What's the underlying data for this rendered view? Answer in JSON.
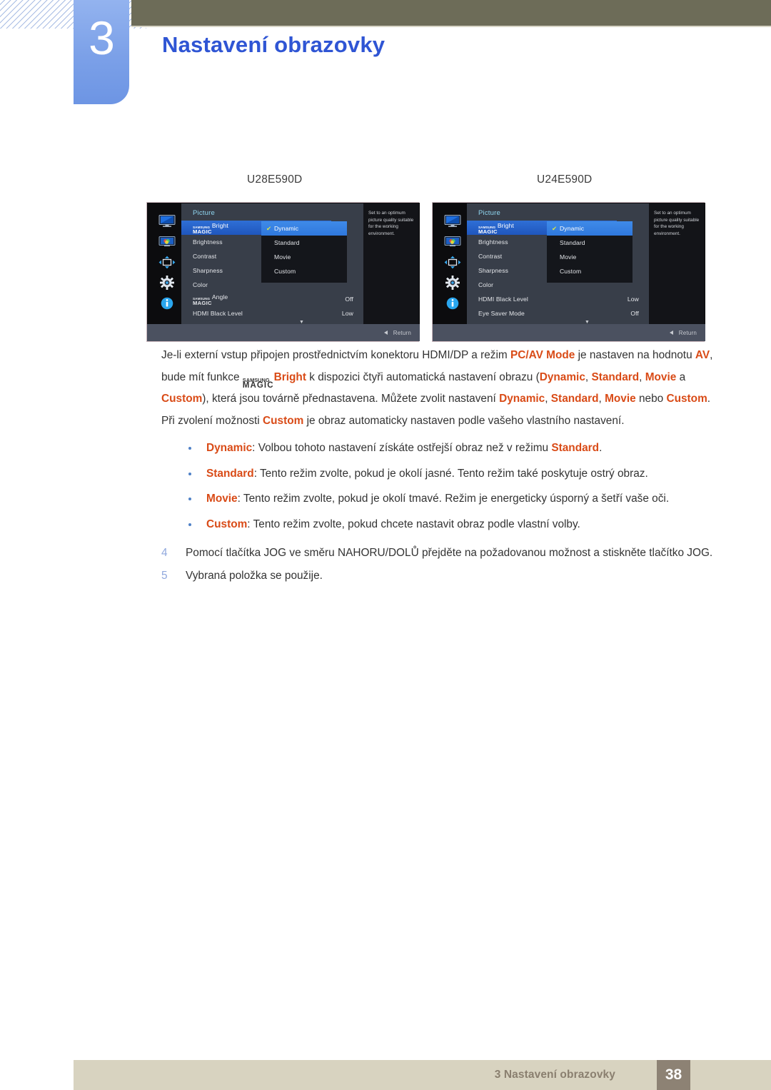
{
  "header": {
    "chapter_number": "3",
    "chapter_title": "Nastavení obrazovky",
    "accent_blue": "#2f55d4",
    "tab_blue": "#7ba0e8",
    "bar_olive": "#6d6c58"
  },
  "models": {
    "left_label": "U28E590D",
    "right_label": "U24E590D"
  },
  "osd": {
    "title": "Picture",
    "description": "Set to an optimum picture quality suitable for the working environment.",
    "return_label": "Return",
    "scroll_caret": "▼",
    "check_glyph": "✔",
    "magic_top": "SAMSUNG",
    "magic_bottom": "MAGIC",
    "rail_icons": [
      "monitor-display-icon",
      "picture-color-icon",
      "four-arrows-position-icon",
      "gear-settings-icon",
      "info-icon"
    ],
    "submenu_items": [
      {
        "label": "Dynamic",
        "selected": true
      },
      {
        "label": "Standard",
        "selected": false
      },
      {
        "label": "Movie",
        "selected": false
      },
      {
        "label": "Custom",
        "selected": false
      }
    ],
    "left_rows": [
      {
        "label": "Bright",
        "magic": true,
        "value": "",
        "selected": true
      },
      {
        "label": "Brightness",
        "magic": false,
        "value": "",
        "selected": false
      },
      {
        "label": "Contrast",
        "magic": false,
        "value": "",
        "selected": false
      },
      {
        "label": "Sharpness",
        "magic": false,
        "value": "",
        "selected": false
      },
      {
        "label": "Color",
        "magic": false,
        "value": "",
        "selected": false
      },
      {
        "label": "Angle",
        "magic": true,
        "value": "Off",
        "selected": false
      },
      {
        "label": "HDMI Black Level",
        "magic": false,
        "value": "Low",
        "selected": false
      }
    ],
    "right_rows": [
      {
        "label": "Bright",
        "magic": true,
        "value": "",
        "selected": true
      },
      {
        "label": "Brightness",
        "magic": false,
        "value": "",
        "selected": false
      },
      {
        "label": "Contrast",
        "magic": false,
        "value": "",
        "selected": false
      },
      {
        "label": "Sharpness",
        "magic": false,
        "value": "",
        "selected": false
      },
      {
        "label": "Color",
        "magic": false,
        "value": "",
        "selected": false
      },
      {
        "label": "HDMI Black Level",
        "magic": false,
        "value": "Low",
        "selected": false
      },
      {
        "label": "Eye Saver Mode",
        "magic": false,
        "value": "Off",
        "selected": false
      }
    ]
  },
  "content": {
    "paragraph_parts": {
      "p1": "Je-li externí vstup připojen prostřednictvím konektoru HDMI/DP a režim ",
      "hl_pcav": "PC/AV Mode",
      "p2": " je nastaven na hodnotu ",
      "hl_av": "AV",
      "p3": ", bude mít funkce ",
      "hl_bright": "Bright",
      "p4": " k dispozici čtyři automatická nastavení obrazu (",
      "hl_dynamic1": "Dynamic",
      "p5": ", ",
      "hl_standard1": "Standard",
      "p6": ", ",
      "hl_movie1": "Movie",
      "p7": " a ",
      "hl_custom1": "Custom",
      "p8": "), která jsou továrně přednastavena. Můžete zvolit nastavení ",
      "hl_dynamic2": "Dynamic",
      "p9": ", ",
      "hl_standard2": "Standard",
      "p10": ", ",
      "hl_movie2": "Movie",
      "p11": " nebo ",
      "hl_custom2": "Custom",
      "p12": ". Při zvolení možnosti ",
      "hl_custom3": "Custom",
      "p13": " je obraz automaticky nastaven podle vašeho vlastního nastavení."
    },
    "bullets": [
      {
        "term": "Dynamic",
        "text_before": ": Volbou tohoto nastavení získáte ostřejší obraz než v režimu ",
        "term2": "Standard",
        "text_after": "."
      },
      {
        "term": "Standard",
        "text_before": ": Tento režim zvolte, pokud je okolí jasné. Tento režim také poskytuje ostrý obraz.",
        "term2": "",
        "text_after": ""
      },
      {
        "term": "Movie",
        "text_before": ": Tento režim zvolte, pokud je okolí tmavé. Režim je energeticky úsporný a šetří vaše oči.",
        "term2": "",
        "text_after": ""
      },
      {
        "term": "Custom",
        "text_before": ": Tento režim zvolte, pokud chcete nastavit obraz podle vlastní volby.",
        "term2": "",
        "text_after": ""
      }
    ],
    "steps": [
      {
        "number": "4",
        "text": "Pomocí tlačítka JOG ve směru NAHORU/DOLŮ přejděte na požadovanou možnost a stiskněte tlačítko JOG."
      },
      {
        "number": "5",
        "text": "Vybraná položka se použije."
      }
    ]
  },
  "footer": {
    "text": "3 Nastavení obrazovky",
    "page_number": "38",
    "band_color": "#d8d3c0",
    "page_box_color": "#8d8274"
  }
}
